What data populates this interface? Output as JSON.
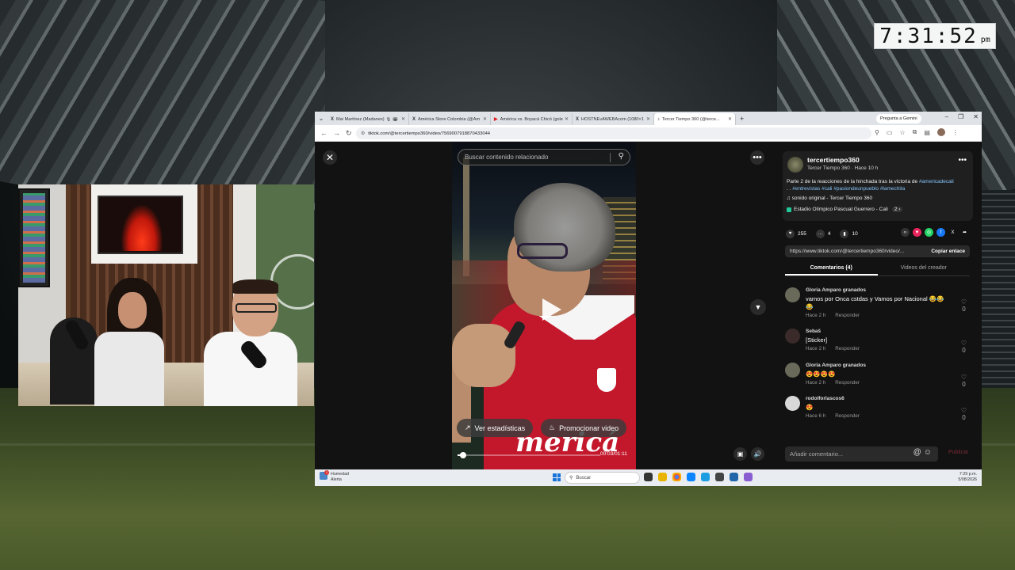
{
  "clock": {
    "time": "7:31:52",
    "ampm": "pm"
  },
  "browser": {
    "tabs": [
      {
        "icon": "X",
        "label": "Mai Martínez (Madanes) 🎙 🏟 ",
        "active": false
      },
      {
        "icon": "X",
        "label": "América Store Colombia (@Am",
        "active": false
      },
      {
        "icon": "▶",
        "label": "América vs. Boyacá Chicó (goles",
        "active": false
      },
      {
        "icon": "X",
        "label": "HOSTNEvAWEBAcom (1080×1",
        "active": false
      },
      {
        "icon": "♪",
        "label": "Tercer Tiempo 360 (@terce...",
        "active": true
      }
    ],
    "new_tab": "+",
    "gemini_label": "Pregunta a Gemini",
    "url": "tiktok.com/@tercertiempo360/video/7569007918870433044"
  },
  "tiktok": {
    "search_placeholder": "Buscar contenido relacionado",
    "video": {
      "shirt_text": "mericá",
      "stats_button": "Ver estadísticas",
      "promote_button": "Promocionar video",
      "timecode": "00:03/01:11",
      "progress": 0.04
    },
    "author": {
      "handle": "tercertiempo360",
      "subtitle": "Tercer Tiempo 360 · Hace 10 h"
    },
    "description": {
      "text": "Parte 2 de la reacciones de la hinchada tras la victoria de ",
      "tags_line1": "#americadecali",
      "line2_prefix": ". . ",
      "tags_line2": "#entrevistas #cali #pasiondeunpueblo #lamechita"
    },
    "sound": "♫  sonido original - Tercer Tiempo 360",
    "location": "Estadio Olímpico Pascual Guerrero - Cali",
    "location_extra": "2 ›",
    "stats": {
      "likes": "255",
      "comments": "4",
      "saves": "10"
    },
    "share_link": "https://www.tiktok.com/@tercertiempo360/video/...",
    "copy_link": "Copiar enlace",
    "tabs": {
      "comments": "Comentarios (4)",
      "creator": "Videos del creador"
    },
    "comments": [
      {
        "user": "Gloria Amparo granados",
        "text": "vamos por Onca cstdas y Vamos por Nacional 😂😂😂",
        "time": "Hace 2 h",
        "reply": "Responder",
        "likes": "0"
      },
      {
        "user": "Sebaš",
        "text": "[Sticker]",
        "time": "Hace 2 h",
        "reply": "Responder",
        "likes": "0"
      },
      {
        "user": "Gloria Amparo granados",
        "text": "😍😍😍😍",
        "time": "Hace 2 h",
        "reply": "Responder",
        "likes": "0"
      },
      {
        "user": "rodolforlascos6",
        "text": "😍",
        "time": "Hace 6 h",
        "reply": "Responder",
        "likes": "0"
      }
    ],
    "comment_placeholder": "Añadir comentario...",
    "publish": "Publicar"
  },
  "taskbar": {
    "weather_line1": "Humedad",
    "weather_line2": "Alerta",
    "weather_badge": "1",
    "search": "Buscar",
    "time": "7:29 p.m.",
    "date": "5/08/2026"
  },
  "colors": {
    "tiktok_tag": "#84c3f8",
    "shirt_red": "#c3182c",
    "publish": "#7a2a36"
  }
}
